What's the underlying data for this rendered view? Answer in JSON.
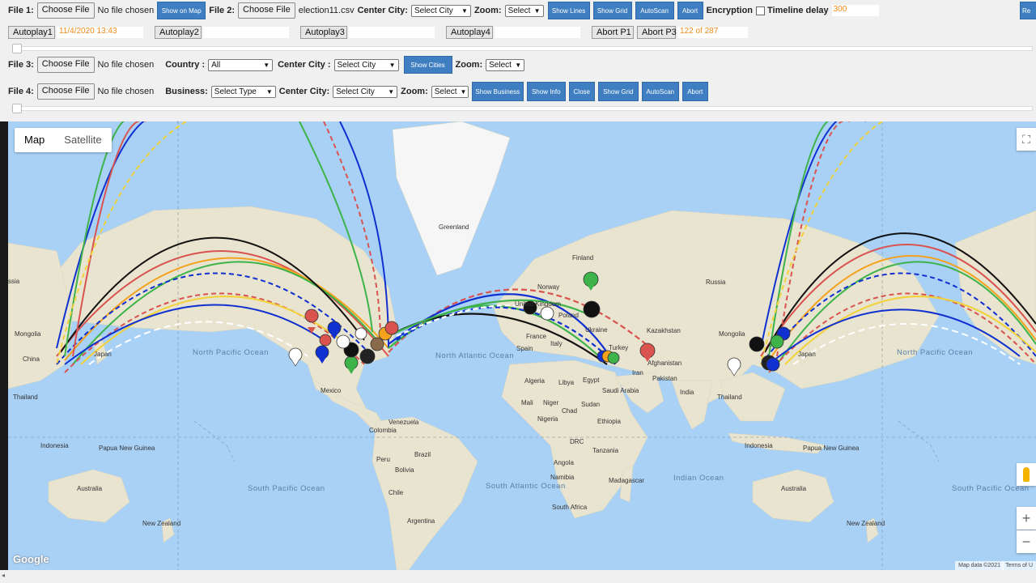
{
  "toolbar1": {
    "file1_label": "File 1:",
    "file1_button": "Choose File",
    "file1_status": "No file chosen",
    "show_on_map": "Show on Map",
    "file2_label": "File 2:",
    "file2_button": "Choose File",
    "file2_name": "election11.csv",
    "center_city_label": "Center City:",
    "center_city_value": "Select City",
    "zoom_label": "Zoom:",
    "zoom_value": "Select",
    "show_lines": "Show Lines",
    "show_grid": "Show Grid",
    "autoscan": "AutoScan",
    "abort": "Abort",
    "encryption_label": "Encryption",
    "timeline_label": "Timeline delay",
    "timeline_value": "300",
    "reset_button": "Re"
  },
  "autoplay": {
    "ap1": "Autoplay1",
    "ap1_time": "11/4/2020 13:43",
    "ap2": "Autoplay2",
    "ap3": "Autoplay3",
    "ap4": "Autoplay4",
    "abort_p1": "Abort P1",
    "abort_p3": "Abort P3",
    "progress": "122 of 287"
  },
  "toolbar3": {
    "file3_label": "File 3:",
    "file3_button": "Choose File",
    "file3_status": "No file chosen",
    "country_label": "Country :",
    "country_value": "All",
    "center_city_label": "Center City :",
    "center_city_value": "Select City",
    "show_cities": "Show Cities",
    "zoom_label": "Zoom:",
    "zoom_value": "Select"
  },
  "toolbar4": {
    "file4_label": "File 4:",
    "file4_button": "Choose File",
    "file4_status": "No file chosen",
    "business_label": "Business:",
    "business_value": "Select Type",
    "center_city_label": "Center City:",
    "center_city_value": "Select City",
    "zoom_label": "Zoom:",
    "zoom_value": "Select",
    "show_business": "Show Business",
    "show_info": "Show Info",
    "close": "Close",
    "show_grid": "Show Grid",
    "autoscan": "AutoScan",
    "abort": "Abort"
  },
  "map": {
    "type_map": "Map",
    "type_satellite": "Satellite",
    "google": "Google",
    "map_data": "Map data ©2021",
    "terms": "Terms of U",
    "labels": {
      "greenland": "Greenland",
      "finland": "Finland",
      "norway": "Norway",
      "russia": "Russia",
      "kazakhstan": "Kazakhstan",
      "mongolia": "Mongolia",
      "mongolia2": "Mongolia",
      "ukraine": "Ukraine",
      "poland": "Poland",
      "france": "France",
      "spain": "Spain",
      "italy": "Italy",
      "united_kingdom": "United Kingdom",
      "turkey": "Turkey",
      "iran": "Iran",
      "afghanistan": "Afghanistan",
      "pakistan": "Pakistan",
      "india": "India",
      "china": "China",
      "japan": "Japan",
      "japan2": "Japan",
      "thailand": "Thailand",
      "thailand2": "Thailand",
      "indonesia": "Indonesia",
      "indonesia2": "Indonesia",
      "papua": "Papua New Guinea",
      "papua2": "Papua New Guinea",
      "australia": "Australia",
      "australia2": "Australia",
      "new_zealand": "New Zealand",
      "new_zealand2": "New Zealand",
      "mexico": "Mexico",
      "venezuela": "Venezuela",
      "colombia": "Colombia",
      "peru": "Peru",
      "brazil": "Brazil",
      "bolivia": "Bolivia",
      "chile": "Chile",
      "argentina": "Argentina",
      "algeria": "Algeria",
      "libya": "Libya",
      "egypt": "Egypt",
      "mali": "Mali",
      "niger": "Niger",
      "chad": "Chad",
      "sudan": "Sudan",
      "nigeria": "Nigeria",
      "ethiopia": "Ethiopia",
      "drc": "DRC",
      "tanzania": "Tanzania",
      "angola": "Angola",
      "namibia": "Namibia",
      "madagascar": "Madagascar",
      "south_africa": "South Africa",
      "saudi_arabia": "Saudi Arabia",
      "north_pacific": "North Pacific Ocean",
      "north_atlantic": "North Atlantic Ocean",
      "south_pacific": "South Pacific Ocean",
      "south_atlantic": "South Atlantic Ocean",
      "indian_ocean": "Indian Ocean",
      "north_pacific2": "North Pacific Ocean",
      "south_pacific2": "South Pacific Ocean",
      "asia_left": "ssia"
    }
  },
  "colors": {
    "accent_blue": "#3f7fc1",
    "timestamp_orange": "#f08a18",
    "ocean": "#a9d1f6",
    "land": "#e8e4cf",
    "ice": "#f6f6f6",
    "arc_red": "#d9534f",
    "arc_blue": "#1030d0",
    "arc_green": "#3db34a",
    "arc_orange": "#f4a21e",
    "arc_yellow": "#f2d23a",
    "arc_black": "#111111",
    "arc_white": "#ffffff"
  }
}
